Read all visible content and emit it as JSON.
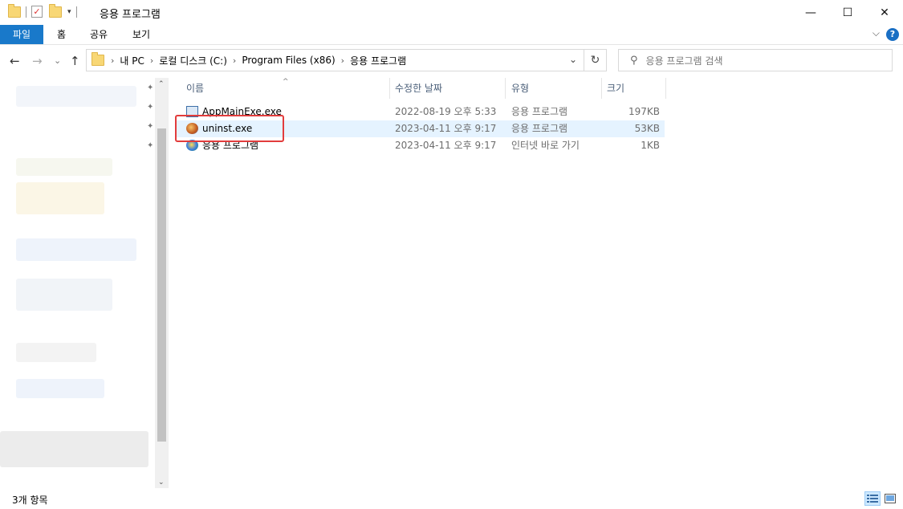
{
  "window": {
    "title": "응용 프로그램",
    "minimize_glyph": "—",
    "maximize_glyph": "☐",
    "close_glyph": "✕"
  },
  "ribbon": {
    "tabs": [
      "파일",
      "홈",
      "공유",
      "보기"
    ],
    "help_glyph": "?",
    "expand_glyph": "⌵"
  },
  "nav": {
    "back_glyph": "←",
    "forward_glyph": "→",
    "recent_glyph": "⌄",
    "up_glyph": "↑",
    "breadcrumbs": [
      "내 PC",
      "로컬 디스크 (C:)",
      "Program Files (x86)",
      "응용 프로그램"
    ],
    "refresh_glyph": "↻"
  },
  "search": {
    "placeholder": "응용 프로그램 검색"
  },
  "columns": [
    "이름",
    "수정한 날짜",
    "유형",
    "크기"
  ],
  "files": [
    {
      "name": "AppMainExe.exe",
      "modified": "2022-08-19 오후 5:33",
      "type": "응용 프로그램",
      "size": "197KB",
      "icon": "exe-icon"
    },
    {
      "name": "uninst.exe",
      "modified": "2023-04-11 오후 9:17",
      "type": "응용 프로그램",
      "size": "53KB",
      "icon": "uninstaller-icon"
    },
    {
      "name": "응용 프로그램",
      "modified": "2023-04-11 오후 9:17",
      "type": "인터넷 바로 가기",
      "size": "1KB",
      "icon": "internet-shortcut-icon"
    }
  ],
  "status": {
    "item_count": "3개 항목"
  },
  "colors": {
    "file_tab": "#1979ca",
    "selected_row": "#e5f3ff",
    "highlight_box": "#e23c3c"
  }
}
